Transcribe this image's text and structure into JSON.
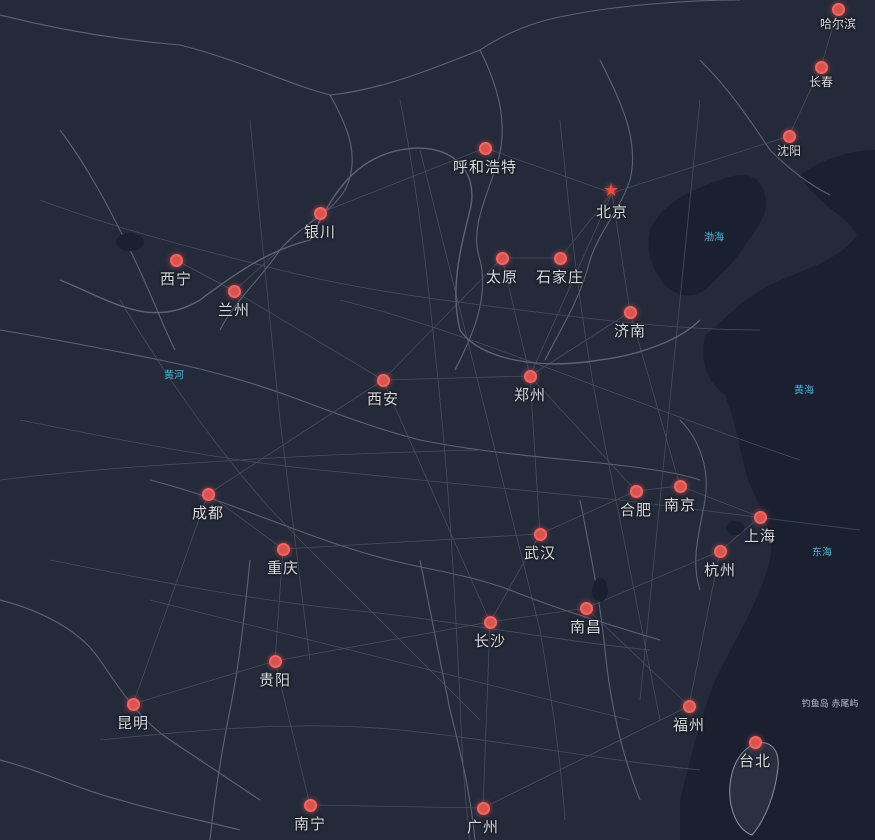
{
  "colors": {
    "land": "#242a3a",
    "sea": "#1b2030",
    "road": "#4a5266",
    "border": "#8b90a0",
    "marker": "#d9534f",
    "label": "#d6d9e0",
    "water_label": "#4fb3d9"
  },
  "cities": [
    {
      "id": "beijing",
      "name": "北京",
      "icon": "star-icon"
    },
    {
      "id": "harbin",
      "name": "哈尔滨",
      "icon": "dot-icon"
    },
    {
      "id": "changchun",
      "name": "长春",
      "icon": "dot-icon"
    },
    {
      "id": "shenyang",
      "name": "沈阳",
      "icon": "dot-icon"
    },
    {
      "id": "hohhot",
      "name": "呼和浩特",
      "icon": "dot-icon"
    },
    {
      "id": "yinchuan",
      "name": "银川",
      "icon": "dot-icon"
    },
    {
      "id": "xining",
      "name": "西宁",
      "icon": "dot-icon"
    },
    {
      "id": "lanzhou",
      "name": "兰州",
      "icon": "dot-icon"
    },
    {
      "id": "taiyuan",
      "name": "太原",
      "icon": "dot-icon"
    },
    {
      "id": "shijiazhuang",
      "name": "石家庄",
      "icon": "dot-icon"
    },
    {
      "id": "jinan",
      "name": "济南",
      "icon": "dot-icon"
    },
    {
      "id": "xian",
      "name": "西安",
      "icon": "dot-icon"
    },
    {
      "id": "zhengzhou",
      "name": "郑州",
      "icon": "dot-icon"
    },
    {
      "id": "chengdu",
      "name": "成都",
      "icon": "dot-icon"
    },
    {
      "id": "chongqing",
      "name": "重庆",
      "icon": "dot-icon"
    },
    {
      "id": "hefei",
      "name": "合肥",
      "icon": "dot-icon"
    },
    {
      "id": "nanjing",
      "name": "南京",
      "icon": "dot-icon"
    },
    {
      "id": "shanghai",
      "name": "上海",
      "icon": "dot-icon"
    },
    {
      "id": "wuhan",
      "name": "武汉",
      "icon": "dot-icon"
    },
    {
      "id": "hangzhou",
      "name": "杭州",
      "icon": "dot-icon"
    },
    {
      "id": "changsha",
      "name": "长沙",
      "icon": "dot-icon"
    },
    {
      "id": "nanchang",
      "name": "南昌",
      "icon": "dot-icon"
    },
    {
      "id": "guiyang",
      "name": "贵阳",
      "icon": "dot-icon"
    },
    {
      "id": "kunming",
      "name": "昆明",
      "icon": "dot-icon"
    },
    {
      "id": "fuzhou",
      "name": "福州",
      "icon": "dot-icon"
    },
    {
      "id": "taipei",
      "name": "台北",
      "icon": "dot-icon"
    },
    {
      "id": "nanning",
      "name": "南宁",
      "icon": "dot-icon"
    },
    {
      "id": "guangzhou",
      "name": "广州",
      "icon": "dot-icon"
    }
  ],
  "waters": [
    {
      "id": "bohai",
      "name": "渤海"
    },
    {
      "id": "huanghai",
      "name": "黄海"
    },
    {
      "id": "donghai",
      "name": "东海"
    },
    {
      "id": "huanghe",
      "name": "黄河"
    }
  ],
  "islands": [
    {
      "id": "diaoyu",
      "name": "钓鱼岛 赤尾屿"
    }
  ]
}
